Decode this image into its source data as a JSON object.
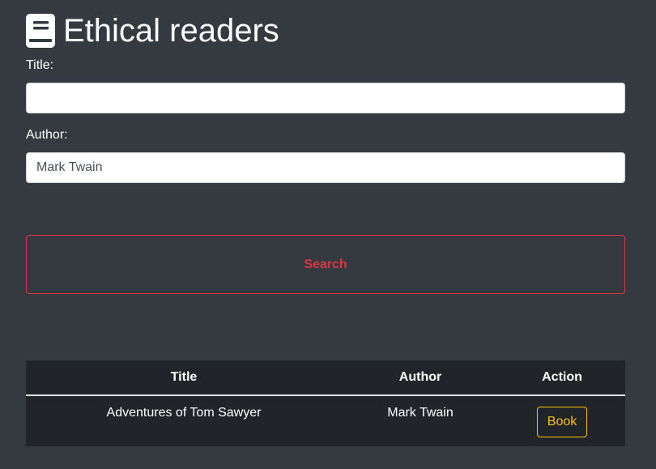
{
  "header": {
    "title": "Ethical readers",
    "icon": "book-icon"
  },
  "form": {
    "title_label": "Title:",
    "title_value": "",
    "author_label": "Author:",
    "author_value": "Mark Twain",
    "search_label": "Search"
  },
  "table": {
    "headers": [
      "Title",
      "Author",
      "Action"
    ],
    "rows": [
      {
        "title": "Adventures of Tom Sawyer",
        "author": "Mark Twain",
        "action": "Book"
      }
    ]
  },
  "colors": {
    "background": "#343a40",
    "table_background": "#212529",
    "danger": "#dc3545",
    "warning": "#ffc107"
  }
}
